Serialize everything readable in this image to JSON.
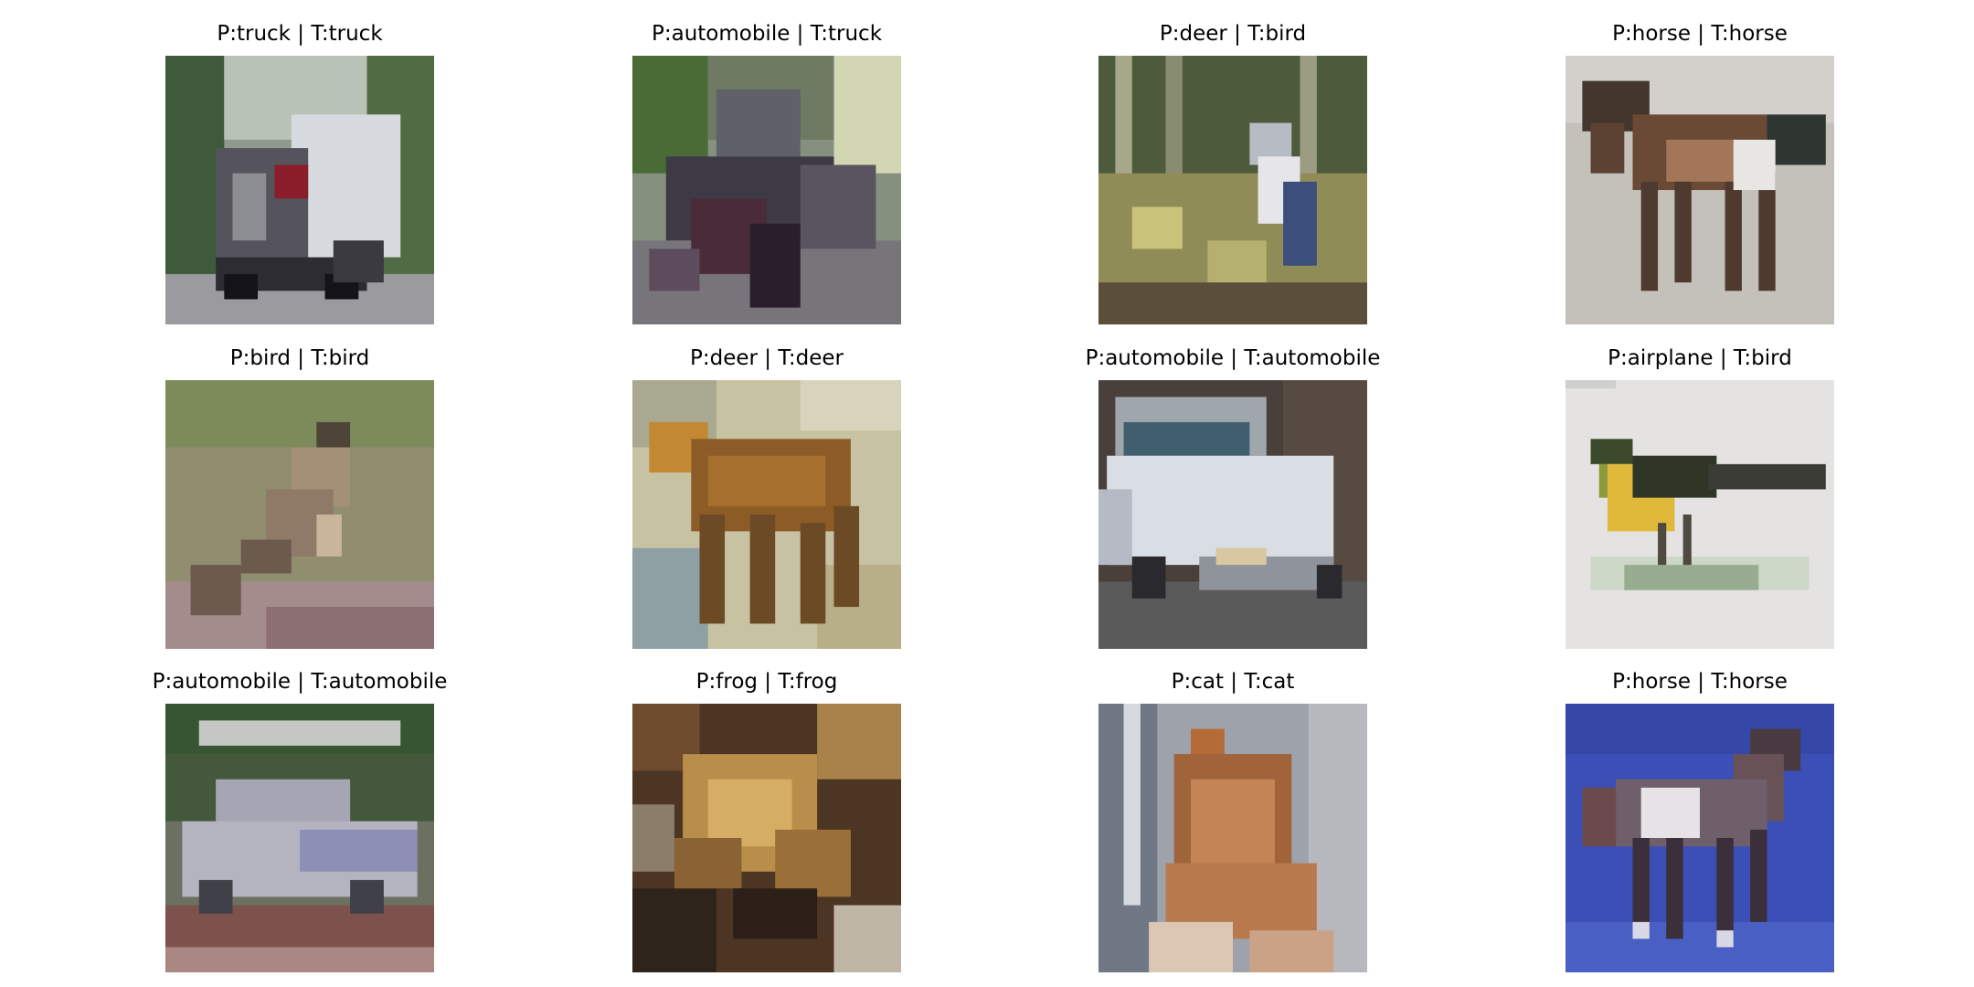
{
  "figure": {
    "panels": [
      {
        "title": "P:truck | T:truck",
        "subject": "truck",
        "predicted": "truck",
        "true": "truck"
      },
      {
        "title": "P:automobile | T:truck",
        "subject": "truck",
        "predicted": "automobile",
        "true": "truck"
      },
      {
        "title": "P:deer | T:bird",
        "subject": "bird",
        "predicted": "deer",
        "true": "bird"
      },
      {
        "title": "P:horse | T:horse",
        "subject": "horse",
        "predicted": "horse",
        "true": "horse"
      },
      {
        "title": "P:bird | T:bird",
        "subject": "bird",
        "predicted": "bird",
        "true": "bird"
      },
      {
        "title": "P:deer | T:deer",
        "subject": "deer",
        "predicted": "deer",
        "true": "deer"
      },
      {
        "title": "P:automobile | T:automobile",
        "subject": "automobile",
        "predicted": "automobile",
        "true": "automobile"
      },
      {
        "title": "P:airplane | T:bird",
        "subject": "bird",
        "predicted": "airplane",
        "true": "bird"
      },
      {
        "title": "P:automobile | T:automobile",
        "subject": "automobile",
        "predicted": "automobile",
        "true": "automobile"
      },
      {
        "title": "P:frog | T:frog",
        "subject": "frog",
        "predicted": "frog",
        "true": "frog"
      },
      {
        "title": "P:cat | T:cat",
        "subject": "cat",
        "predicted": "cat",
        "true": "cat"
      },
      {
        "title": "P:horse | T:horse",
        "subject": "horse",
        "predicted": "horse",
        "true": "horse"
      }
    ]
  }
}
